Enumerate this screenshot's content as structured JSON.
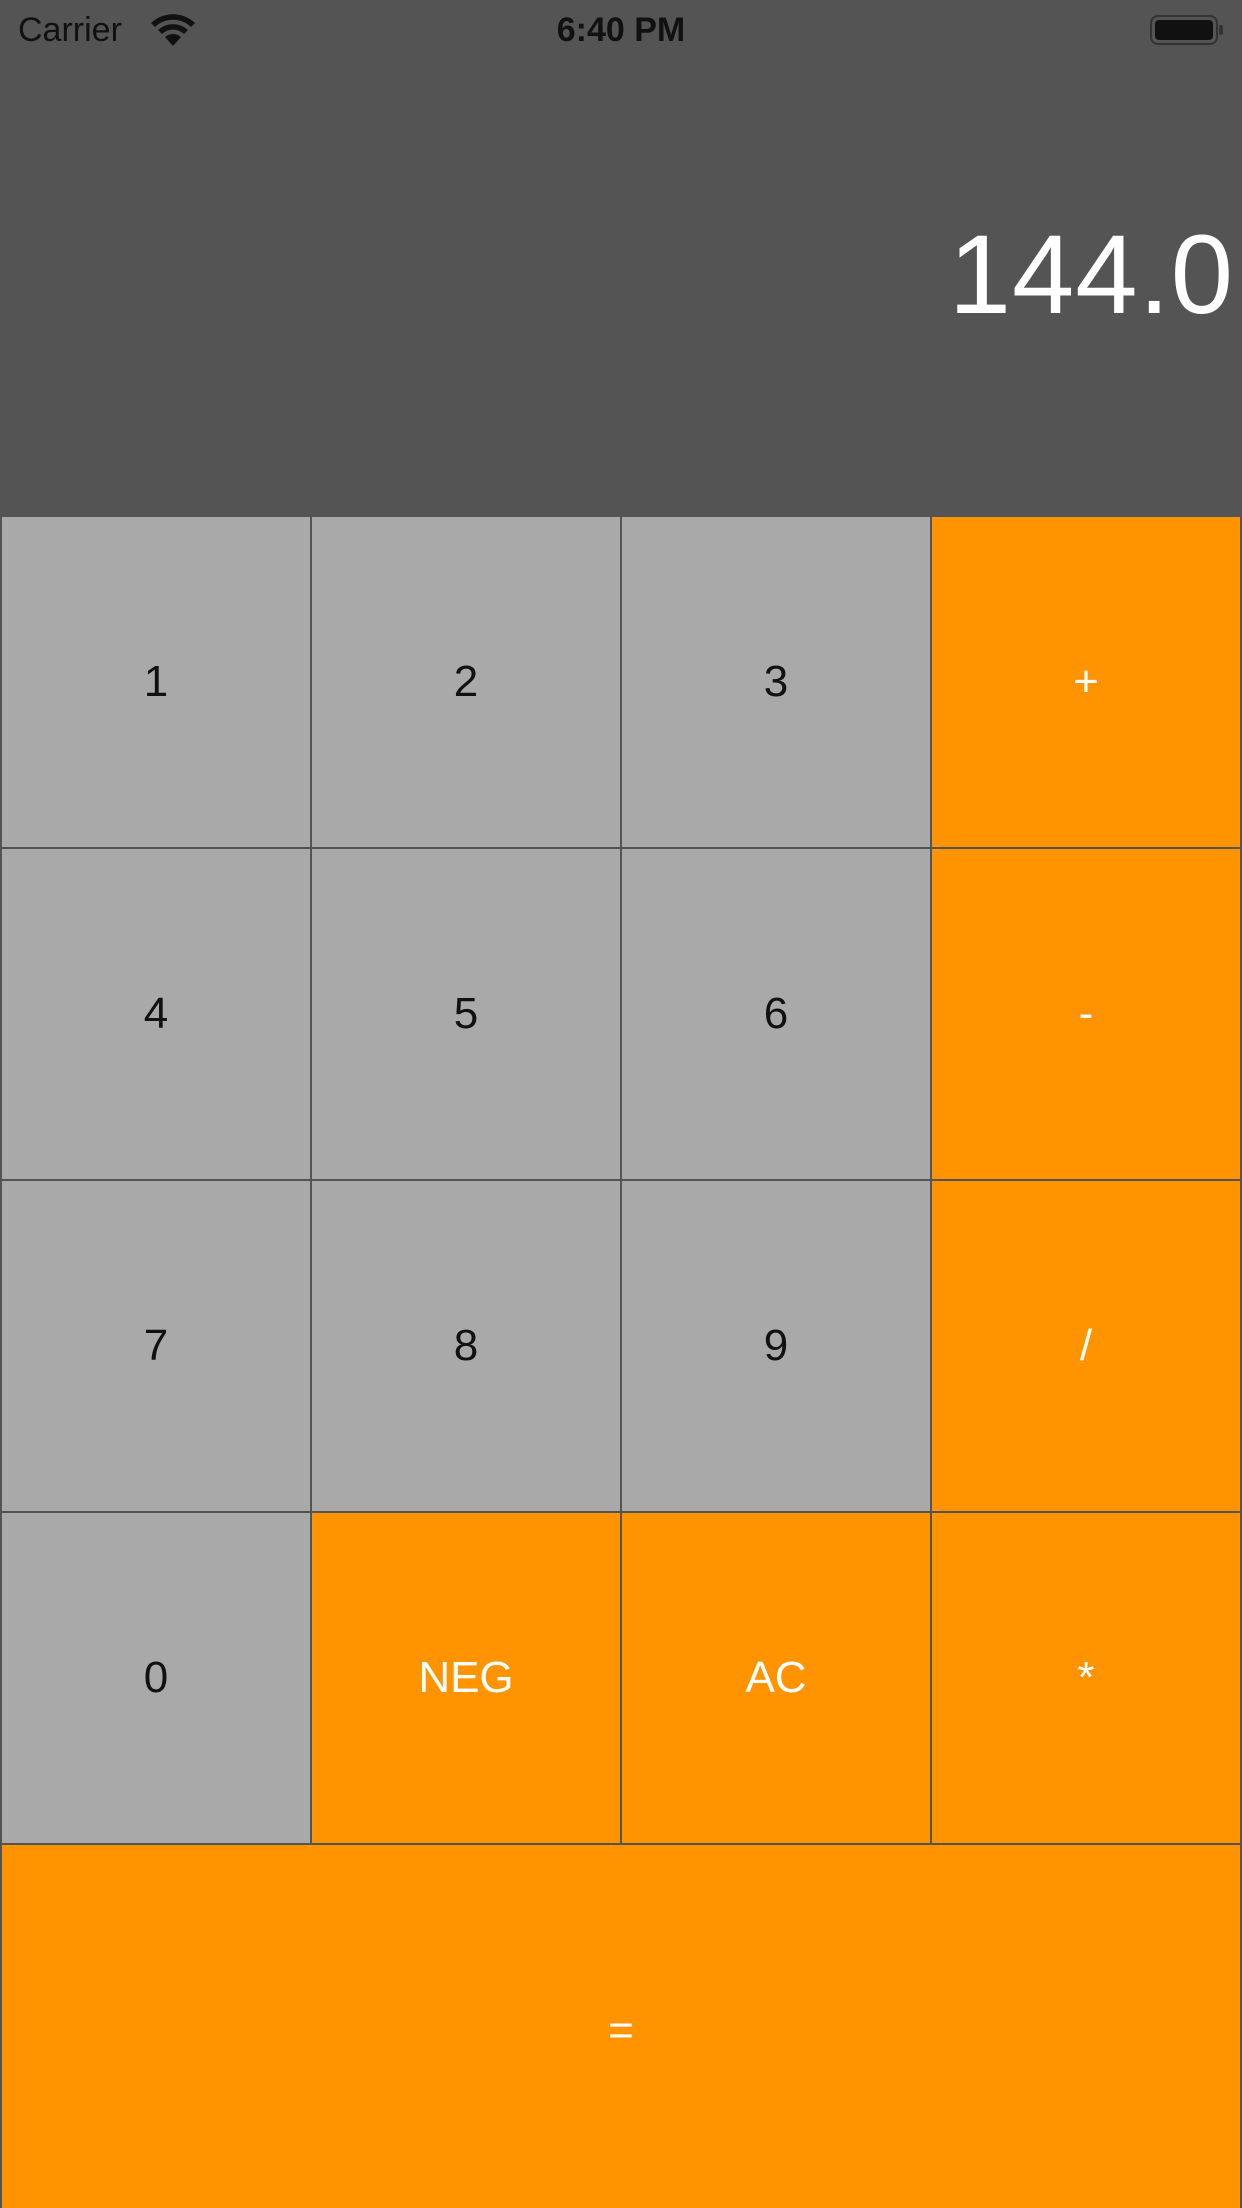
{
  "status_bar": {
    "carrier": "Carrier",
    "time": "6:40 PM",
    "wifi_icon": "wifi-icon",
    "battery_icon": "battery-icon"
  },
  "display": {
    "value": "144.0"
  },
  "colors": {
    "background": "#545454",
    "number_key": "#a9a9a9",
    "operator_key": "#ff9400",
    "number_text": "#111111",
    "operator_text": "#ffffff"
  },
  "keys": {
    "k1": "1",
    "k2": "2",
    "k3": "3",
    "plus": "+",
    "k4": "4",
    "k5": "5",
    "k6": "6",
    "minus": "-",
    "k7": "7",
    "k8": "8",
    "k9": "9",
    "divide": "/",
    "k0": "0",
    "neg": "NEG",
    "ac": "AC",
    "multiply": "*",
    "equals": "="
  }
}
